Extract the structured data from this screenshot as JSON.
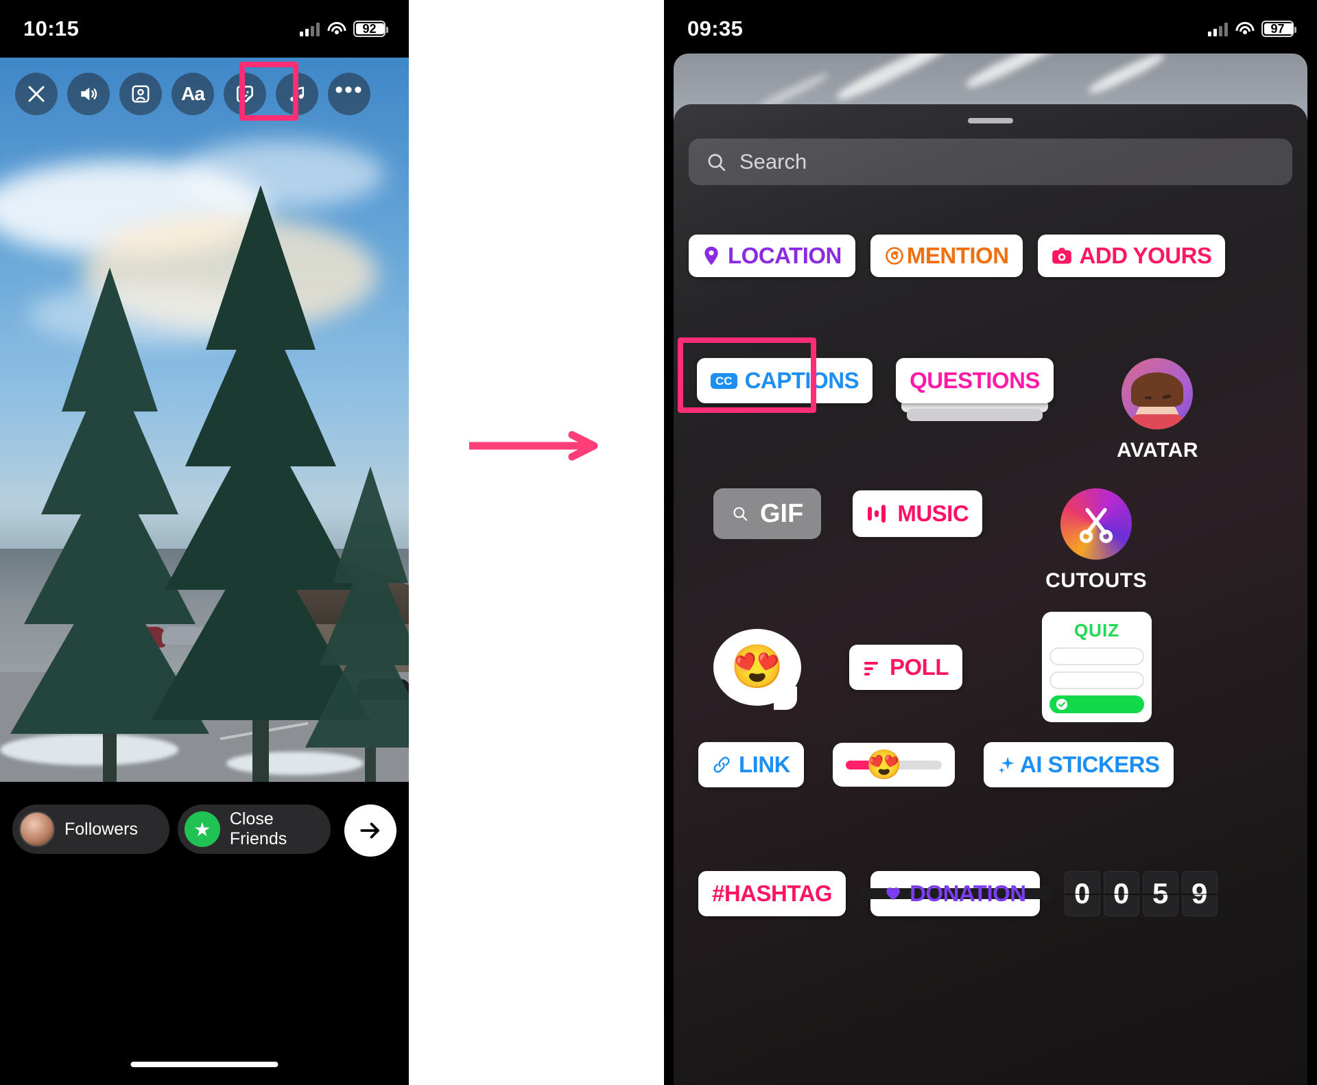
{
  "left_phone": {
    "status": {
      "time": "10:15",
      "battery": "92",
      "signal_icon": "cellular-signal-icon",
      "wifi_icon": "wifi-icon"
    },
    "toolbar": {
      "items": [
        {
          "name": "close",
          "label": "✕",
          "icon": "close-icon"
        },
        {
          "name": "sound",
          "label": "",
          "icon": "volume-icon"
        },
        {
          "name": "tag-people",
          "label": "",
          "icon": "person-card-icon"
        },
        {
          "name": "text",
          "label": "Aa",
          "icon": "text-icon"
        },
        {
          "name": "sticker",
          "label": "",
          "icon": "sticker-smiley-icon"
        },
        {
          "name": "music",
          "label": "",
          "icon": "music-note-icon"
        },
        {
          "name": "more",
          "label": "•••",
          "icon": "more-options-icon"
        }
      ],
      "highlight_target": "sticker"
    },
    "bottom": {
      "followers_label": "Followers",
      "close_friends_label": "Close Friends",
      "next_icon": "arrow-right-icon",
      "avatar_icon": "user-avatar",
      "star_icon": "star-icon"
    }
  },
  "arrow": {
    "icon": "right-arrow-icon",
    "color": "#ff3d77"
  },
  "right_phone": {
    "status": {
      "time": "09:35",
      "battery": "97",
      "signal_icon": "cellular-signal-icon",
      "wifi_icon": "wifi-icon"
    },
    "tray": {
      "grabber": "drag-handle",
      "search": {
        "placeholder": "Search",
        "icon": "search-icon"
      },
      "highlight_target": "CAPTIONS",
      "rows": [
        {
          "items": [
            {
              "label": "LOCATION",
              "color": "#8a2be2",
              "icon": "location-pin-icon",
              "style": "white-pill"
            },
            {
              "label": "MENTION",
              "color": "#f0700f",
              "icon": "at-threads-icon",
              "style": "white-pill"
            },
            {
              "label": "ADD YOURS",
              "color": "#ff1764",
              "icon": "camera-icon",
              "style": "white-pill"
            }
          ]
        },
        {
          "items": [
            {
              "label": "CAPTIONS",
              "color": "#1d8ff2",
              "icon": "cc-badge-icon",
              "style": "white-pill",
              "badge": "CC"
            },
            {
              "label": "QUESTIONS",
              "color": "#ff1aa8",
              "icon": "",
              "style": "stacked-card"
            },
            {
              "label": "AVATAR",
              "color": "#ffffff",
              "icon": "avatar-icon",
              "style": "circle-with-caption"
            }
          ]
        },
        {
          "items": [
            {
              "label": "GIF",
              "color": "#ffffff",
              "icon": "search-icon",
              "style": "gray-pill"
            },
            {
              "label": "MUSIC",
              "color": "#ff0f63",
              "icon": "music-bars-icon",
              "style": "white-pill"
            },
            {
              "label": "CUTOUTS",
              "color": "#ffffff",
              "icon": "scissors-icon",
              "style": "circle-with-caption"
            }
          ]
        },
        {
          "items": [
            {
              "label": "",
              "color": "",
              "icon": "heart-eyes-emoji",
              "emoji": "😍",
              "style": "emoji-bubble"
            },
            {
              "label": "POLL",
              "color": "#ff1464",
              "icon": "poll-bars-icon",
              "style": "white-pill"
            },
            {
              "label": "QUIZ",
              "color": "#1ed94f",
              "icon": "",
              "style": "quiz-card"
            }
          ]
        },
        {
          "items": [
            {
              "label": "LINK",
              "color": "#1d8ff2",
              "icon": "link-chain-icon",
              "style": "white-pill"
            },
            {
              "label": "",
              "color": "",
              "icon": "emoji-slider-icon",
              "emoji": "😍",
              "style": "emoji-slider"
            },
            {
              "label": "AI STICKERS",
              "color": "#1d8ff2",
              "icon": "sparkles-icon",
              "style": "white-pill"
            }
          ]
        },
        {
          "items": [
            {
              "label": "#HASHTAG",
              "color": "#ff1464",
              "icon": "",
              "style": "white-pill"
            },
            {
              "label": "DONATION",
              "color": "#7d3cf0",
              "icon": "heart-icon",
              "style": "white-pill"
            },
            {
              "label": "",
              "color": "#ffffff",
              "icon": "countdown-icon",
              "style": "countdown",
              "digits": [
                "0",
                "0",
                "5",
                "9"
              ]
            }
          ]
        }
      ],
      "quiz": {
        "title": "QUIZ",
        "rows": 3,
        "correct_index": 2,
        "check_icon": "check-circle-icon"
      }
    }
  }
}
